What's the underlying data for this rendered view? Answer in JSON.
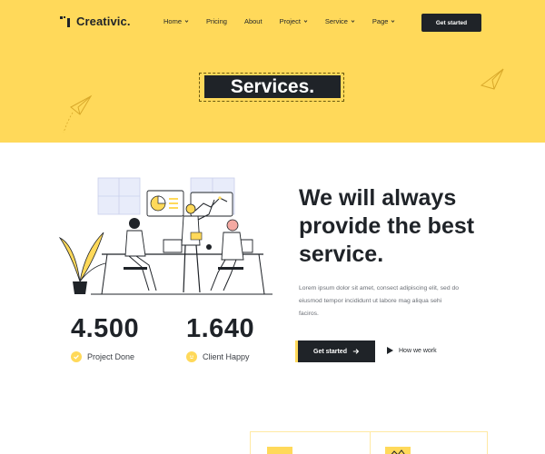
{
  "brand": {
    "name": "Creativic."
  },
  "nav": {
    "items": [
      {
        "label": "Home",
        "dropdown": true
      },
      {
        "label": "Pricing",
        "dropdown": false
      },
      {
        "label": "About",
        "dropdown": false
      },
      {
        "label": "Project",
        "dropdown": true
      },
      {
        "label": "Service",
        "dropdown": true
      },
      {
        "label": "Page",
        "dropdown": true
      }
    ],
    "cta": "Get started"
  },
  "hero": {
    "title": "Services."
  },
  "main": {
    "headline": "We will always provide the best service.",
    "description": "Lorem ipsum dolor sit amet, consect adipiscing elit, sed do eiusmod tempor incididunt ut labore mag aliqua sehi faciros.",
    "primary_button": "Get started",
    "secondary_button": "How we work"
  },
  "stats": [
    {
      "value": "4.500",
      "label": "Project Done",
      "icon": "check-circle-icon"
    },
    {
      "value": "1.640",
      "label": "Client Happy",
      "icon": "smile-icon"
    }
  ],
  "colors": {
    "accent": "#ffd95a",
    "dark": "#1f2328"
  }
}
